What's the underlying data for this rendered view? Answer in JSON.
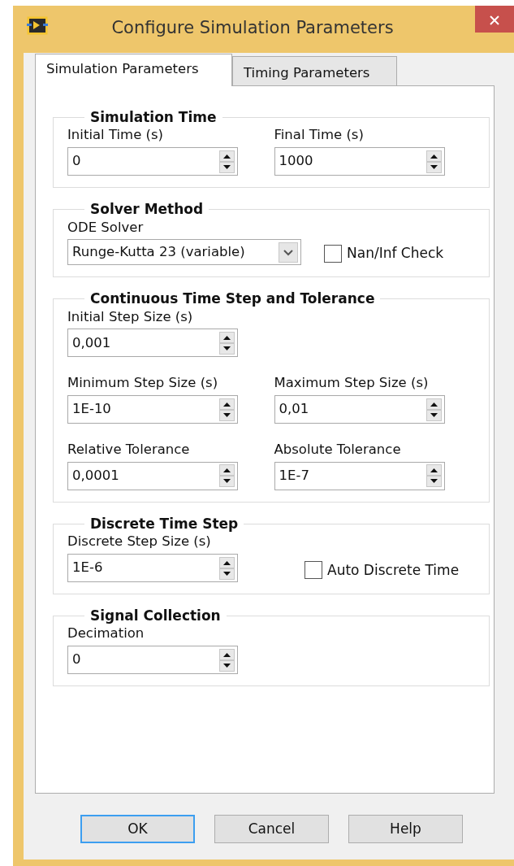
{
  "window": {
    "title": "Configure Simulation Parameters"
  },
  "tabs": [
    {
      "label": "Simulation Parameters",
      "selected": true
    },
    {
      "label": "Timing Parameters",
      "selected": false
    }
  ],
  "groups": [
    {
      "title": "Simulation Time",
      "rows": [
        [
          {
            "kind": "numeric",
            "label": "Initial Time (s)",
            "value": "0"
          },
          {
            "kind": "numeric",
            "label": "Final Time (s)",
            "value": "1000"
          }
        ]
      ]
    },
    {
      "title": "Solver Method",
      "rows": [
        [
          {
            "kind": "dropdown",
            "label": "ODE Solver",
            "value": "Runge-Kutta 23 (variable)"
          },
          {
            "kind": "checkbox",
            "label": "Nan/Inf Check",
            "checked": false
          }
        ]
      ]
    },
    {
      "title": "Continuous Time Step and Tolerance",
      "rows": [
        [
          {
            "kind": "numeric",
            "label": "Initial Step Size (s)",
            "value": "0,001"
          }
        ],
        [
          {
            "kind": "numeric",
            "label": "Minimum Step Size (s)",
            "value": "1E-10"
          },
          {
            "kind": "numeric",
            "label": "Maximum Step Size (s)",
            "value": "0,01"
          }
        ],
        [
          {
            "kind": "numeric",
            "label": "Relative Tolerance",
            "value": "0,0001"
          },
          {
            "kind": "numeric",
            "label": "Absolute Tolerance",
            "value": "1E-7"
          }
        ]
      ]
    },
    {
      "title": "Discrete Time Step",
      "rows": [
        [
          {
            "kind": "numeric",
            "label": "Discrete Step Size (s)",
            "value": "1E-6"
          },
          {
            "kind": "checkbox",
            "label": "Auto Discrete Time",
            "checked": false
          }
        ]
      ]
    },
    {
      "title": "Signal Collection",
      "rows": [
        [
          {
            "kind": "numeric",
            "label": "Decimation",
            "value": "0"
          }
        ]
      ]
    }
  ],
  "buttons": [
    {
      "label": "OK",
      "focused": true
    },
    {
      "label": "Cancel",
      "focused": false
    },
    {
      "label": "Help",
      "focused": false
    }
  ]
}
